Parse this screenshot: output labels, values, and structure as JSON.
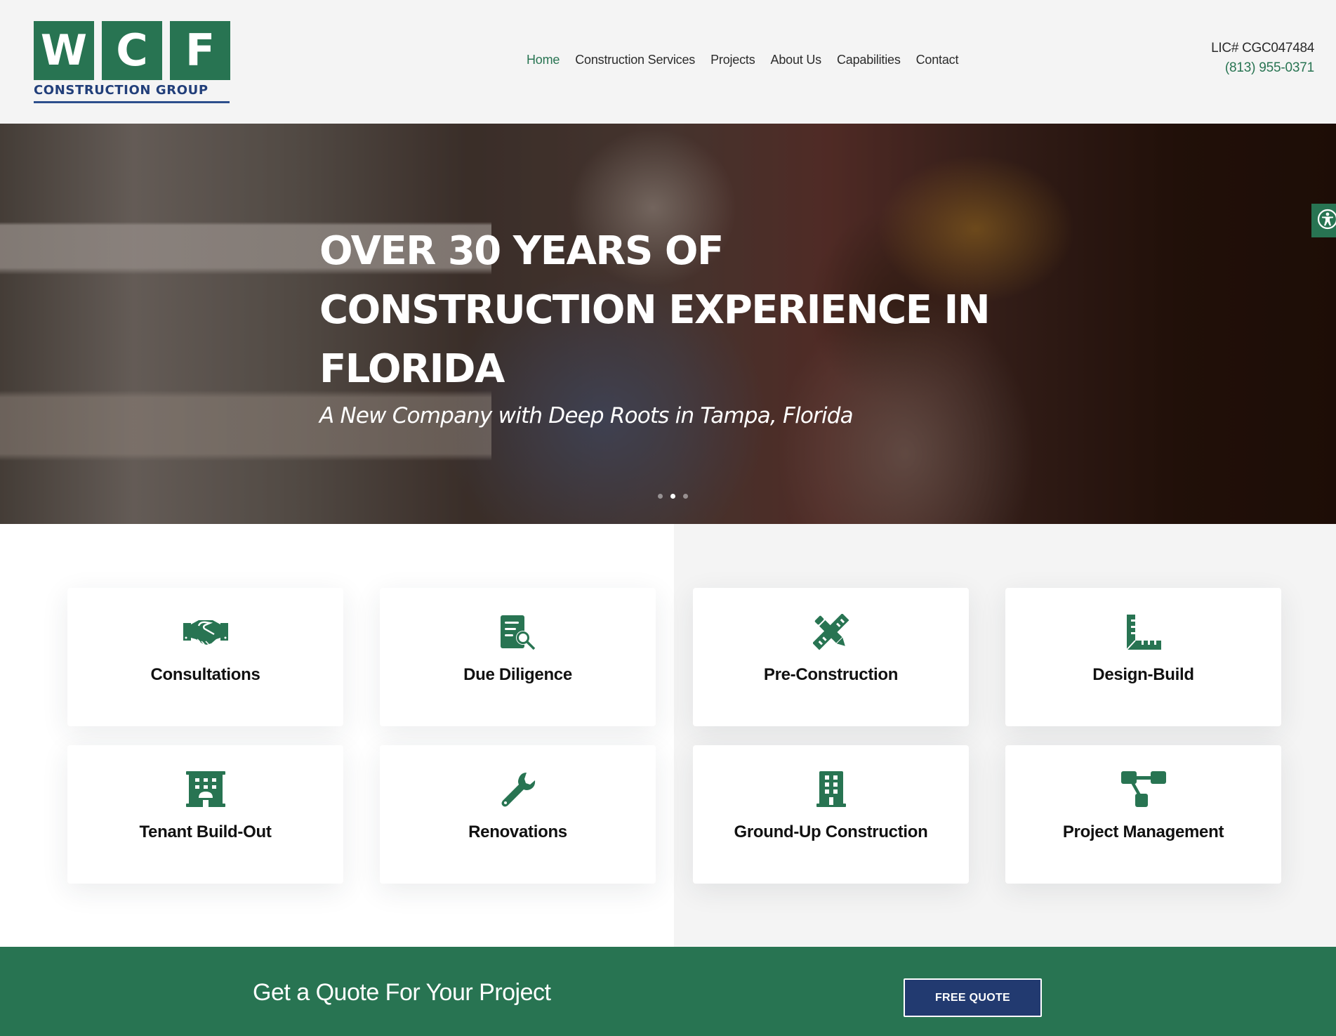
{
  "brand": {
    "logo_letters": [
      "W",
      "C",
      "F"
    ],
    "logo_subtitle": "CONSTRUCTION GROUP",
    "colors": {
      "green": "#287452",
      "navy": "#223a70",
      "header_bg": "#f4f4f4"
    }
  },
  "nav": {
    "items": [
      {
        "label": "Home",
        "active": true
      },
      {
        "label": "Construction Services",
        "active": false
      },
      {
        "label": "Projects",
        "active": false
      },
      {
        "label": "About Us",
        "active": false
      },
      {
        "label": "Capabilities",
        "active": false
      },
      {
        "label": "Contact",
        "active": false
      }
    ]
  },
  "contact": {
    "license": "LIC# CGC047484",
    "phone": "(813) 955-0371"
  },
  "hero": {
    "title_lines": [
      "OVER 30 YEARS OF",
      "CONSTRUCTION EXPERIENCE IN",
      "FLORIDA"
    ],
    "subtitle": "A New Company with Deep Roots in Tampa, Florida",
    "slides": 3,
    "active_slide": 2
  },
  "accessibility": {
    "icon": "accessibility-icon"
  },
  "services": [
    {
      "label": "Consultations",
      "icon": "handshake-icon"
    },
    {
      "label": "Due Diligence",
      "icon": "document-search-icon"
    },
    {
      "label": "Pre-Construction",
      "icon": "pencil-ruler-icon"
    },
    {
      "label": "Design-Build",
      "icon": "ruler-combined-icon"
    },
    {
      "label": "Tenant Build-Out",
      "icon": "hotel-building-icon"
    },
    {
      "label": "Renovations",
      "icon": "wrench-icon"
    },
    {
      "label": "Ground-Up Construction",
      "icon": "building-icon"
    },
    {
      "label": "Project Management",
      "icon": "sitemap-icon"
    }
  ],
  "cta": {
    "text": "Get a Quote For Your Project",
    "button_label": "FREE QUOTE"
  }
}
